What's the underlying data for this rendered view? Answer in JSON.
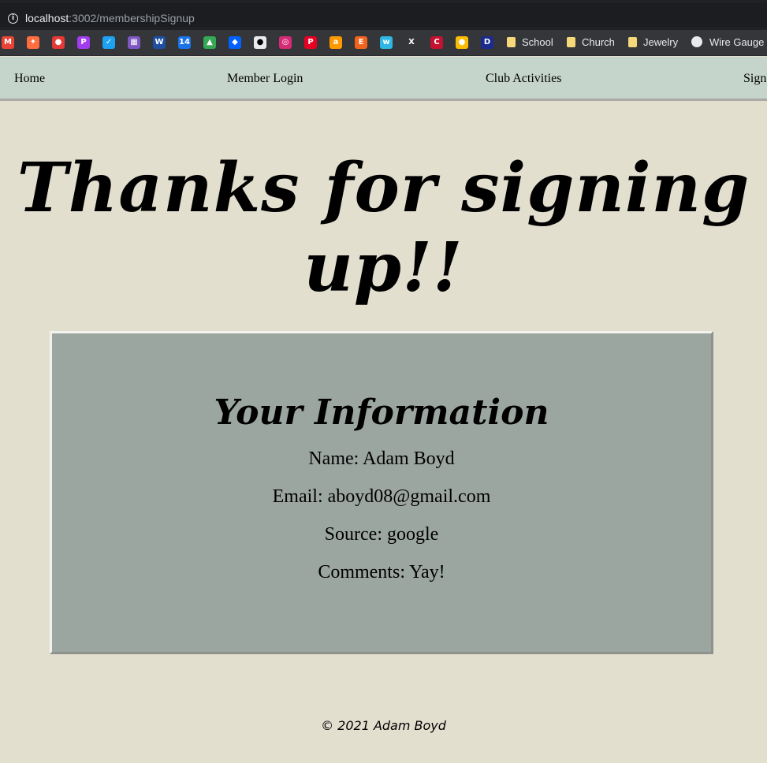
{
  "browser": {
    "url_host": "localhost",
    "url_rest": ":3002/membershipSignup",
    "bookmarks": [
      {
        "icon": "gmail-icon",
        "color": "#ea4335",
        "glyph": "M"
      },
      {
        "icon": "app-icon",
        "color": "#ff6d3f",
        "glyph": "✦"
      },
      {
        "icon": "tomato-icon",
        "color": "#e53935",
        "glyph": "●"
      },
      {
        "icon": "picsart-icon",
        "color": "#a33cf0",
        "glyph": "P"
      },
      {
        "icon": "twitter-icon",
        "color": "#1da1f2",
        "glyph": "✓"
      },
      {
        "icon": "gift-icon",
        "color": "#7e57c2",
        "glyph": "▦"
      },
      {
        "icon": "weather-channel-icon",
        "color": "#1e4fa3",
        "glyph": "W"
      },
      {
        "icon": "calendar-icon",
        "color": "#1a73e8",
        "glyph": "14"
      },
      {
        "icon": "google-drive-icon",
        "color": "#34a853",
        "glyph": "▲"
      },
      {
        "icon": "dropbox-icon",
        "color": "#0061ff",
        "glyph": "◆"
      },
      {
        "icon": "github-icon",
        "color": "#e8eaed",
        "glyph": "●"
      },
      {
        "icon": "instagram-icon",
        "color": "#d62976",
        "glyph": "◎"
      },
      {
        "icon": "pinterest-icon",
        "color": "#e60023",
        "glyph": "P"
      },
      {
        "icon": "amazon-icon",
        "color": "#ff9900",
        "glyph": "a"
      },
      {
        "icon": "etsy-icon",
        "color": "#f1641e",
        "glyph": "E"
      },
      {
        "icon": "wattpad-icon",
        "color": "#2eb6e4",
        "glyph": "w"
      },
      {
        "icon": "x-icon",
        "color": "#35363a",
        "glyph": "X"
      },
      {
        "icon": "chegg-icon",
        "color": "#c41230",
        "glyph": "C"
      },
      {
        "icon": "chrome-icon",
        "color": "#fbbc04",
        "glyph": "●"
      },
      {
        "icon": "disney-icon",
        "color": "#1c2b8f",
        "glyph": "D"
      }
    ],
    "folders": [
      "School",
      "Church",
      "Jewelry"
    ],
    "web_link": "Wire Gauge to"
  },
  "nav": {
    "home": "Home",
    "login": "Member Login",
    "activities": "Club Activities",
    "signup": "Sign"
  },
  "hero": "Thanks for signing up!!",
  "card": {
    "title": "Your Information",
    "name": "Name: Adam Boyd",
    "email": "Email: aboyd08@gmail.com",
    "source": "Source: google",
    "comments": "Comments: Yay!"
  },
  "footer": "© 2021 Adam Boyd"
}
